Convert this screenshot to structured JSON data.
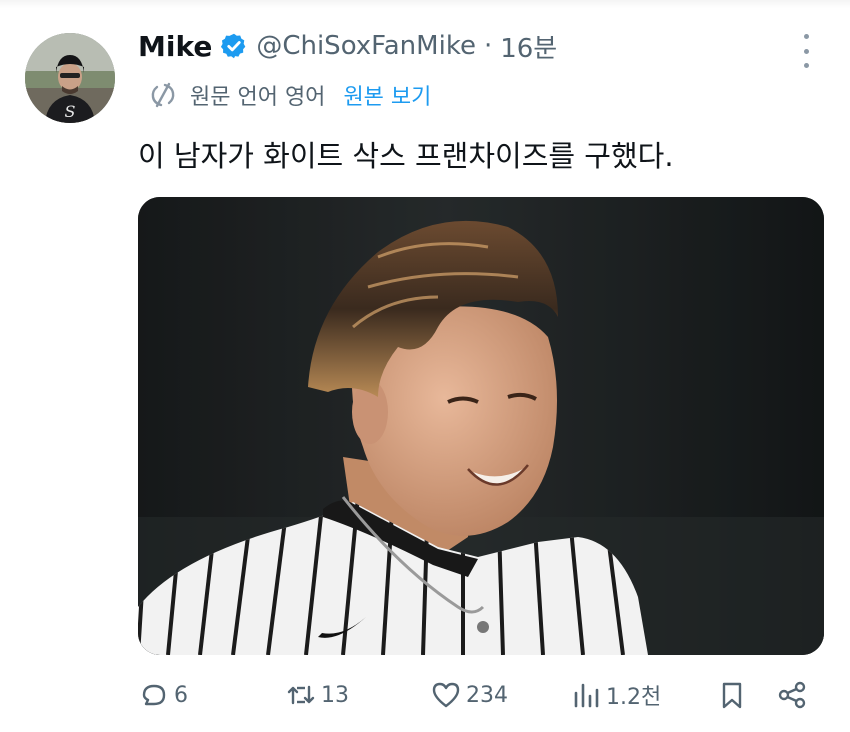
{
  "colors": {
    "text_primary": "#0f1419",
    "text_secondary": "#536471",
    "accent": "#1d9bf0"
  },
  "tweet": {
    "author": {
      "name": "Mike",
      "handle": "@ChiSoxFanMike",
      "verified_icon": "verified-badge-icon"
    },
    "separator": "·",
    "time": "16분",
    "translation": {
      "note": "원문 언어 영어",
      "view_original": "원본 보기"
    },
    "text": "이 남자가 화이트 삭스 프랜차이즈를 구했다.",
    "actions": {
      "replies": "6",
      "retweets": "13",
      "likes": "234",
      "views": "1.2천"
    }
  }
}
